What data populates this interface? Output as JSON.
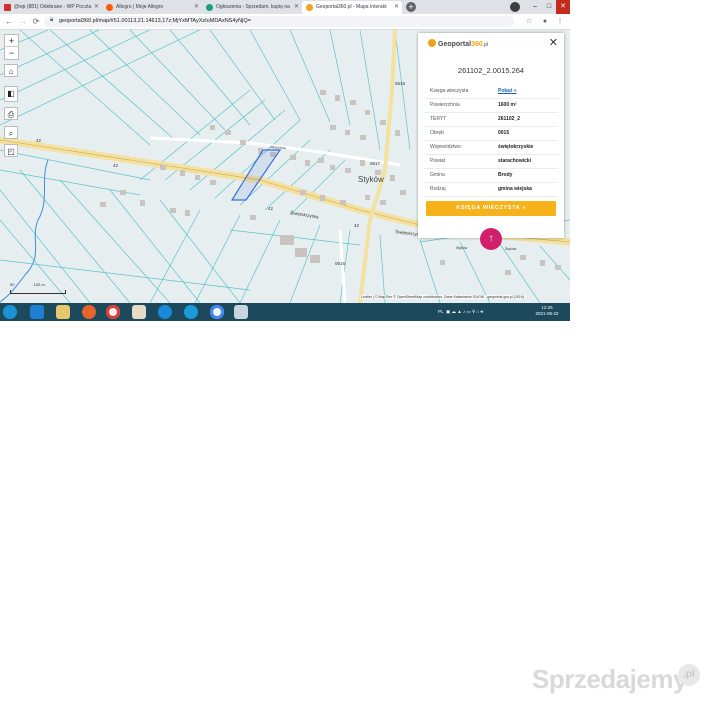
{
  "browser": {
    "tabs": [
      {
        "label": "@wp (881) Odebrane - WP Poczta",
        "favicon_color": "#d32f2f",
        "active": false
      },
      {
        "label": "Allegro | Moje Allegro",
        "favicon_color": "#ff5a00",
        "active": false
      },
      {
        "label": "Ogłoszenia - Sprzedam, kupię na",
        "favicon_color": "#14a085",
        "active": false
      },
      {
        "label": "Geoportal360.pl - Mapa Interakt",
        "favicon_color": "#f0a31a",
        "active": true
      }
    ],
    "new_tab": "+",
    "window_controls": {
      "minimize": "–",
      "maximize": "□",
      "close": "✕"
    },
    "url": "geoportal360.pl/map/#51.00113,21.14613,17z;MjYxMTAyXzIuMDAxNS4yNjQ="
  },
  "map": {
    "controls": {
      "zoom_in": "+",
      "zoom_out": "−"
    },
    "place_label": "Styków",
    "road_labels": {
      "r42_a": "42",
      "r42_b": "42",
      "r42_c": "42",
      "r42_d": "42",
      "r0615": "0615",
      "r0617": "0617",
      "r0616": "0616",
      "street_1": "Świętokrzyska",
      "street_2": "Świętokrzyska",
      "street_3": "Wiosenna"
    },
    "scale": {
      "a": "50",
      "b": "100 m"
    },
    "stops": {
      "a": "Styków",
      "b": "Styków"
    },
    "attribution": "Leaflet | © MapTiler © OpenStreetMap contributors, Dane Katastralne GUGiK - geoportal.gov.pl (2019)"
  },
  "panel": {
    "brand_a": "Geoportal",
    "brand_b": "360",
    "brand_c": ".pl",
    "close": "✕",
    "parcel_id": "261102_2.0015.264",
    "rows": [
      {
        "key": "Księga wieczysta",
        "value": "Pokaż »"
      },
      {
        "key": "Powierzchnia",
        "value": "1600 m²"
      },
      {
        "key": "TERYT",
        "value": "261102_2"
      },
      {
        "key": "Obręb",
        "value": "0015"
      },
      {
        "key": "Województwo",
        "value": "świętokrzyskie"
      },
      {
        "key": "Powiat",
        "value": "starachowicki"
      },
      {
        "key": "Gmina",
        "value": "Brody"
      },
      {
        "key": "Rodzaj",
        "value": "gmina wiejska"
      }
    ],
    "button": "KSIĘGA WIECZYSTA »",
    "fab": "↑"
  },
  "taskbar": {
    "tray_text": "PL",
    "time": "12:26",
    "date": "2021-06-22"
  },
  "watermark": {
    "text": "Sprzedajemy",
    "badge": ".pl"
  },
  "colors": {
    "accent": "#f5b21b",
    "fab": "#d11f6d",
    "parcel": "#3a6fd8",
    "taskbar": "#1c4a5c"
  }
}
